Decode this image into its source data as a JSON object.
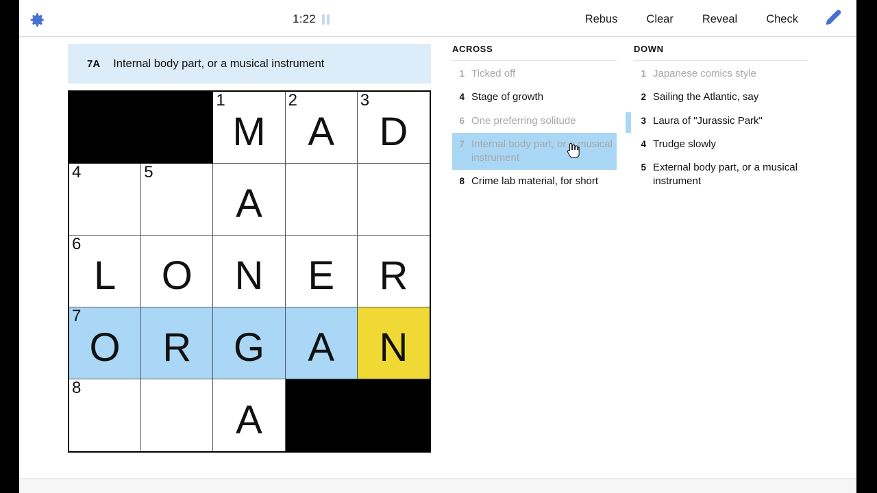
{
  "toolbar": {
    "settings_icon": "gear-icon",
    "timer": "1:22",
    "pause_icon": "pause-icon",
    "rebus_label": "Rebus",
    "clear_label": "Clear",
    "reveal_label": "Reveal",
    "check_label": "Check",
    "pencil_icon": "pencil-icon"
  },
  "current_clue": {
    "number": "7A",
    "text": "Internal body part, or a musical instrument"
  },
  "grid": {
    "rows": 5,
    "cols": 5,
    "cells": [
      {
        "block": true
      },
      {
        "block": true
      },
      {
        "num": "1",
        "letter": "M"
      },
      {
        "num": "2",
        "letter": "A"
      },
      {
        "num": "3",
        "letter": "D"
      },
      {
        "num": "4",
        "letter": ""
      },
      {
        "num": "5",
        "letter": ""
      },
      {
        "num": "",
        "letter": "A"
      },
      {
        "num": "",
        "letter": ""
      },
      {
        "num": "",
        "letter": ""
      },
      {
        "num": "6",
        "letter": "L"
      },
      {
        "num": "",
        "letter": "O"
      },
      {
        "num": "",
        "letter": "N"
      },
      {
        "num": "",
        "letter": "E"
      },
      {
        "num": "",
        "letter": "R"
      },
      {
        "num": "7",
        "letter": "O",
        "state": "highlight"
      },
      {
        "num": "",
        "letter": "R",
        "state": "highlight"
      },
      {
        "num": "",
        "letter": "G",
        "state": "highlight"
      },
      {
        "num": "",
        "letter": "A",
        "state": "highlight"
      },
      {
        "num": "",
        "letter": "N",
        "state": "active"
      },
      {
        "num": "8",
        "letter": ""
      },
      {
        "num": "",
        "letter": ""
      },
      {
        "num": "",
        "letter": "A"
      },
      {
        "block": true
      },
      {
        "block": true
      }
    ]
  },
  "clues": {
    "across": {
      "title": "ACROSS",
      "items": [
        {
          "num": "1",
          "text": "Ticked off",
          "state": "done"
        },
        {
          "num": "4",
          "text": "Stage of growth",
          "state": "todo"
        },
        {
          "num": "6",
          "text": "One preferring solitude",
          "state": "done"
        },
        {
          "num": "7",
          "text": "Internal body part, or a musical instrument",
          "state": "selected"
        },
        {
          "num": "8",
          "text": "Crime lab material, for short",
          "state": "todo"
        }
      ]
    },
    "down": {
      "title": "DOWN",
      "items": [
        {
          "num": "1",
          "text": "Japanese comics style",
          "state": "done"
        },
        {
          "num": "2",
          "text": "Sailing the Atlantic, say",
          "state": "todo"
        },
        {
          "num": "3",
          "text": "Laura of \"Jurassic Park\"",
          "state": "ref"
        },
        {
          "num": "4",
          "text": "Trudge slowly",
          "state": "todo"
        },
        {
          "num": "5",
          "text": "External body part, or a musical instrument",
          "state": "todo"
        }
      ]
    }
  },
  "colors": {
    "highlight": "#a9d7f5",
    "active_cell": "#f0d835",
    "banner_bg": "#ddecf9",
    "accent": "#4571d0"
  }
}
